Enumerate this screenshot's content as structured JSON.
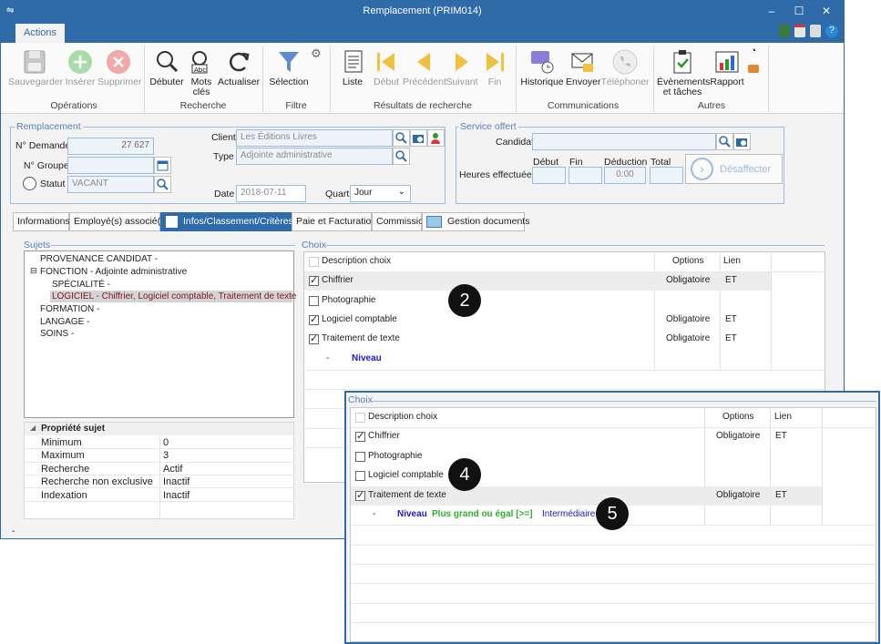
{
  "window": {
    "title": "Remplacement (PRIM014)",
    "tab": "Actions"
  },
  "ribbon": {
    "operations": {
      "label": "Opérations",
      "buttons": [
        "Sauvegarder",
        "Insérer",
        "Supprimer"
      ]
    },
    "recherche": {
      "label": "Recherche",
      "debuter": "Débuter",
      "mots": "Mots",
      "cles": "clés",
      "actualiser": "Actualiser"
    },
    "filtre": {
      "label": "Filtre",
      "selection": "Sélection"
    },
    "resultats": {
      "label": "Résultats de recherche",
      "buttons": [
        "Liste",
        "Début",
        "Précédent",
        "Suivant",
        "Fin"
      ]
    },
    "communications": {
      "label": "Communications",
      "buttons": [
        "Historique",
        "Envoyer",
        "Téléphoner"
      ]
    },
    "autres": {
      "label": "Autres",
      "evenements1": "Évènements",
      "evenements2": "et tâches",
      "rapport": "Rapport"
    }
  },
  "remplacement": {
    "legend": "Remplacement",
    "no_demande_label": "N° Demande",
    "no_demande": "27 627",
    "no_groupe_label": "N° Groupe",
    "no_groupe": "",
    "statut_label": "Statut",
    "statut": "VACANT",
    "client_label": "Client",
    "client": "Les Éditions Livres",
    "type_label": "Type",
    "type": "Adjointe administrative",
    "date_label": "Date",
    "date": "2018-07-11",
    "quart_label": "Quart",
    "quart": "Jour"
  },
  "service": {
    "legend": "Service offert",
    "candidat_label": "Candidat",
    "candidat": "",
    "heures_label": "Heures effectuées",
    "debut_label": "Début",
    "fin_label": "Fin",
    "deduction_label": "Déduction",
    "total_label": "Total",
    "deduction": "0:00",
    "desaffecter": "Désaffecter"
  },
  "tabs": [
    "Informations",
    "Employé(s) associé(s)",
    "Infos/Classement/Critères",
    "Paie et Facturation",
    "Commission",
    "Gestion documents"
  ],
  "sujets": {
    "legend": "Sujets",
    "items": [
      "PROVENANCE CANDIDAT -",
      "FONCTION - Adjointe administrative",
      "SPÉCIALITÉ -",
      "LOGICIEL",
      "FORMATION -",
      "LANGAGE -",
      "SOINS -"
    ],
    "logiciel_detail": " - Chiffrier, Logiciel comptable, Traitement de texte"
  },
  "propriete": {
    "header": "Propriété sujet",
    "rows": [
      {
        "k": "Minimum",
        "v": "0"
      },
      {
        "k": "Maximum",
        "v": "3"
      },
      {
        "k": "Recherche",
        "v": "Actif"
      },
      {
        "k": "Recherche non exclusive",
        "v": "Inactif"
      },
      {
        "k": "Indexation",
        "v": "Inactif"
      }
    ]
  },
  "choix": {
    "legend": "Choix",
    "headers": {
      "desc": "Description choix",
      "options": "Options",
      "lien": "Lien"
    },
    "rows": [
      {
        "desc": "Chiffrier",
        "checked": true,
        "options": "Obligatoire",
        "lien": "ET"
      },
      {
        "desc": "Photographie",
        "checked": false,
        "options": "",
        "lien": ""
      },
      {
        "desc": "Logiciel comptable",
        "checked": true,
        "options": "Obligatoire",
        "lien": "ET"
      },
      {
        "desc": "Traitement de texte",
        "checked": true,
        "options": "Obligatoire",
        "lien": "ET"
      }
    ],
    "niveau_dash": "-",
    "niveau": "Niveau"
  },
  "choix2": {
    "legend": "Choix",
    "headers": {
      "desc": "Description choix",
      "options": "Options",
      "lien": "Lien"
    },
    "rows": [
      {
        "desc": "Chiffrier",
        "checked": true,
        "options": "Obligatoire",
        "lien": "ET"
      },
      {
        "desc": "Photographie",
        "checked": false,
        "options": "",
        "lien": ""
      },
      {
        "desc": "Logiciel comptable",
        "checked": false,
        "options": "",
        "lien": ""
      },
      {
        "desc": "Traitement de texte",
        "checked": true,
        "options": "Obligatoire",
        "lien": "ET"
      }
    ],
    "niveau_dash": "-",
    "niveau": "Niveau",
    "operator": "Plus grand ou égal [>=]",
    "value": "Intermédiaire"
  },
  "badges": [
    "2",
    "4",
    "5"
  ],
  "status_bar": "-"
}
